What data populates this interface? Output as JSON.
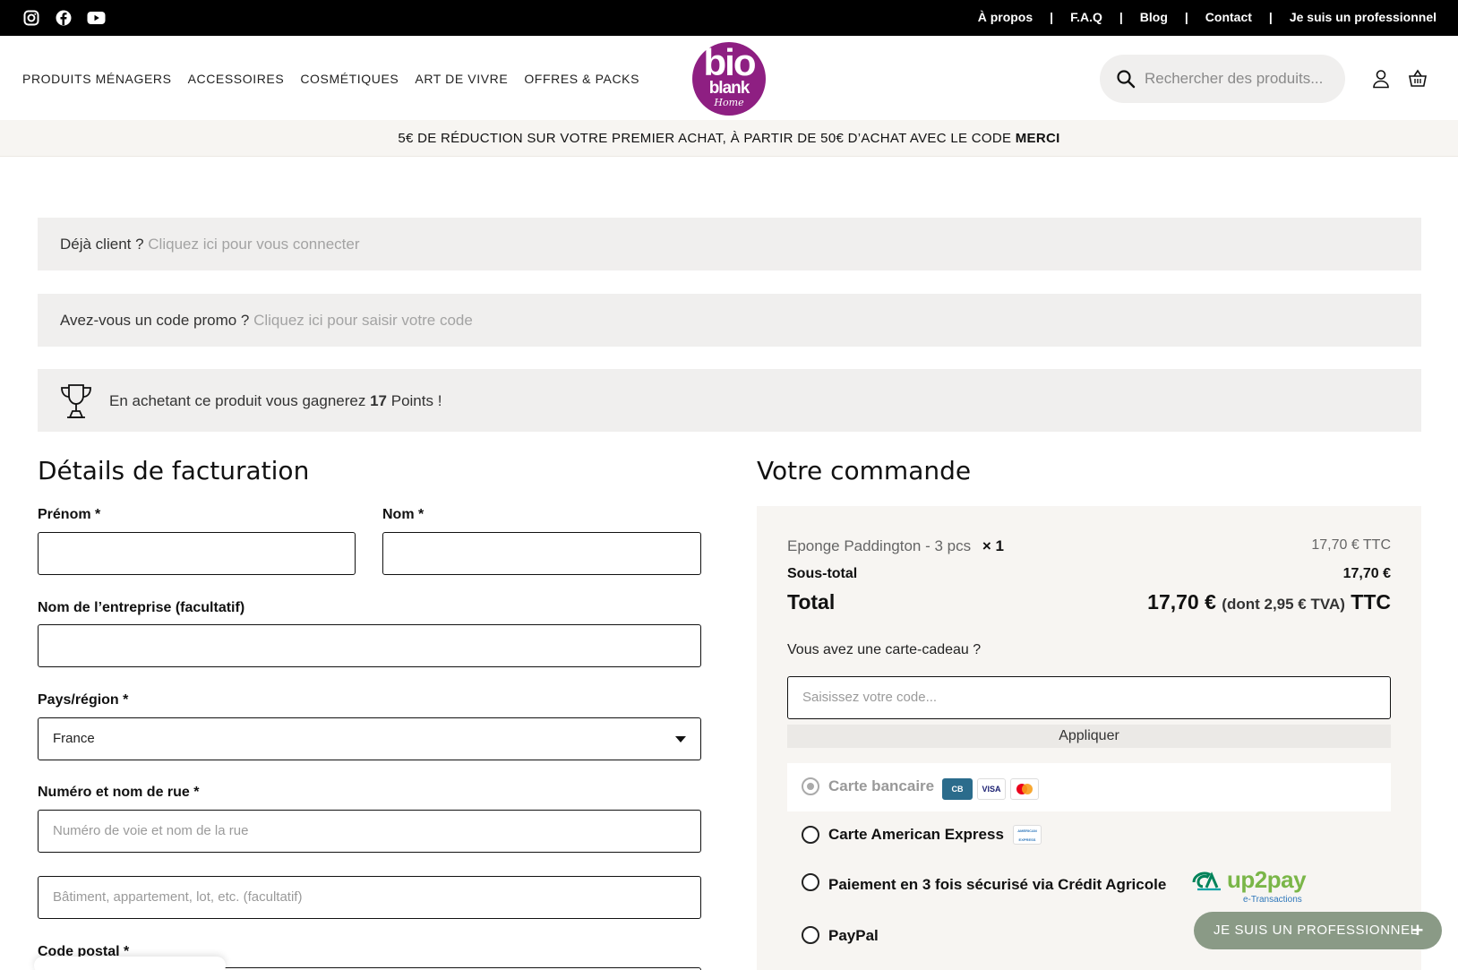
{
  "topbar": {
    "social": [
      "instagram-icon",
      "facebook-icon",
      "youtube-icon"
    ],
    "links": [
      "À propos",
      "F.A.Q",
      "Blog",
      "Contact",
      "Je suis un professionnel"
    ],
    "separator": "|"
  },
  "header": {
    "nav": [
      "PRODUITS MÉNAGERS",
      "ACCESSOIRES",
      "COSMÉTIQUES",
      "ART DE VIVRE",
      "OFFRES & PACKS"
    ],
    "logo": {
      "line1": "bio",
      "line2": "blank",
      "line3": "Home",
      "color": "#8e1f82"
    },
    "search_placeholder": "Rechercher des produits...",
    "icons": [
      "user-icon",
      "basket-icon"
    ]
  },
  "promo": {
    "text": "5€ DE RÉDUCTION SUR VOTRE PREMIER ACHAT, À PARTIR DE 50€ D’ACHAT AVEC LE CODE ",
    "code": "MERCI"
  },
  "notices": {
    "login_prefix": "Déjà client ? ",
    "login_link": "Cliquez ici pour vous connecter",
    "promo_prefix": "Avez-vous un code promo ? ",
    "promo_link": "Cliquez ici pour saisir votre code",
    "points_prefix": "En achetant ce produit vous gagnerez ",
    "points_value": "17",
    "points_suffix": " Points !"
  },
  "billing": {
    "title": "Détails de facturation",
    "first_name_label": "Prénom *",
    "last_name_label": "Nom *",
    "company_label": "Nom de l’entreprise (facultatif)",
    "country_label": "Pays/région *",
    "country_value": "France",
    "street_label": "Numéro et nom de rue *",
    "street_placeholder": "Numéro de voie et nom de la rue",
    "street2_placeholder": "Bâtiment, appartement, lot, etc. (facultatif)",
    "postcode_label": "Code postal *"
  },
  "order": {
    "title": "Votre commande",
    "item_name": "Eponge Paddington - 3 pcs",
    "item_qty": "× 1",
    "item_price": "17,70 € TTC",
    "subtotal_label": "Sous-total",
    "subtotal_value": "17,70 €",
    "total_label": "Total",
    "total_value": "17,70 €",
    "total_tax": "(dont 2,95 € TVA)",
    "total_suffix": "TTC",
    "gift_label": "Vous avez une carte-cadeau ?",
    "gift_placeholder": "Saisissez votre code...",
    "apply_label": "Appliquer",
    "payments": [
      {
        "label": "Carte bancaire",
        "selected": true
      },
      {
        "label": "Carte American Express",
        "selected": false
      },
      {
        "label": "Paiement en 3 fois sécurisé via Crédit Agricole",
        "selected": false
      },
      {
        "label": "PayPal",
        "selected": false
      }
    ],
    "card_logos": {
      "cb": "CB",
      "visa": "VISA",
      "amex": "AMERICAN EXPRESS",
      "up2pay": "up2pay",
      "etrans": "e-Transactions"
    }
  },
  "pro_button": {
    "label": "JE SUIS UN PROFESSIONNEL",
    "plus": "+"
  }
}
